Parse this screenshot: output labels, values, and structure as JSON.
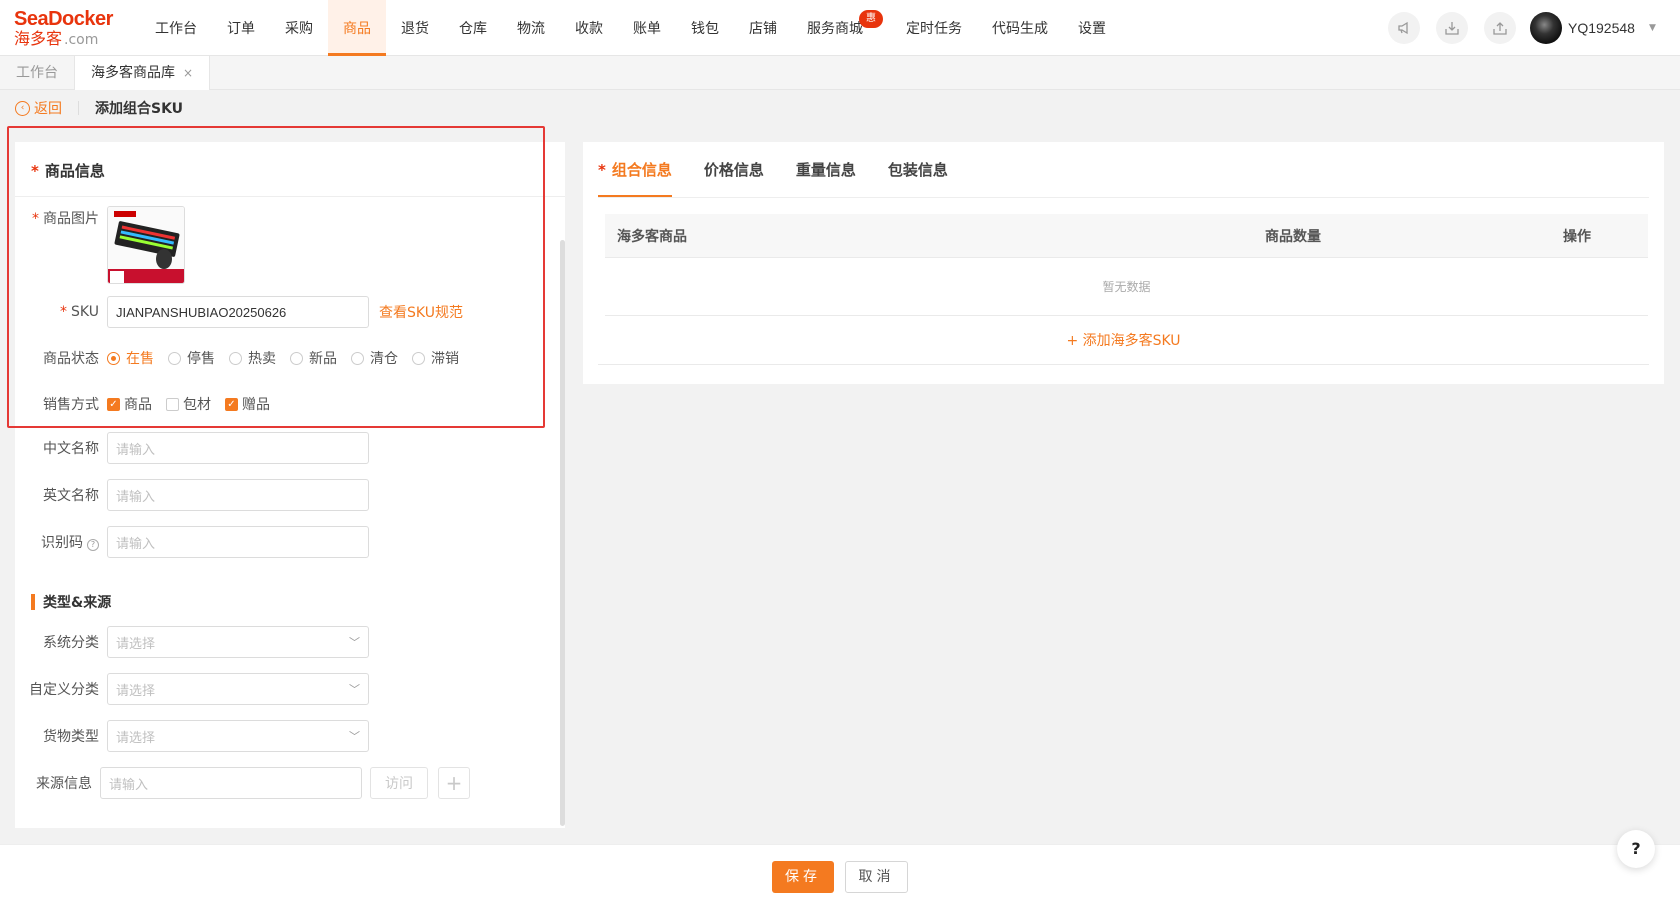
{
  "logo": {
    "brand": "SeaDocker",
    "sub": "海多客",
    "domain": ".com"
  },
  "nav": {
    "items": [
      {
        "label": "工作台"
      },
      {
        "label": "订单"
      },
      {
        "label": "采购"
      },
      {
        "label": "商品"
      },
      {
        "label": "退货"
      },
      {
        "label": "仓库"
      },
      {
        "label": "物流"
      },
      {
        "label": "收款"
      },
      {
        "label": "账单"
      },
      {
        "label": "钱包"
      },
      {
        "label": "店铺"
      },
      {
        "label": "服务商城"
      },
      {
        "label": "定时任务"
      },
      {
        "label": "代码生成"
      },
      {
        "label": "设置"
      }
    ],
    "active_index": 3,
    "badge": "惠",
    "user": "YQ192548"
  },
  "page_tabs": [
    {
      "label": "工作台"
    },
    {
      "label": "海多客商品库",
      "close": "×"
    }
  ],
  "breadcrumb": {
    "back": "返回",
    "title": "添加组合SKU"
  },
  "left": {
    "title": "商品信息",
    "image_label": "商品图片",
    "sku_label": "SKU",
    "sku_value": "JIANPANSHUBIAO20250626",
    "sku_link": "查看SKU规范",
    "status_label": "商品状态",
    "status_options": [
      "在售",
      "停售",
      "热卖",
      "新品",
      "清仓",
      "滞销"
    ],
    "sale_label": "销售方式",
    "sale_options": [
      {
        "label": "商品",
        "checked": true
      },
      {
        "label": "包材",
        "checked": false
      },
      {
        "label": "赠品",
        "checked": true
      }
    ],
    "cn_name_label": "中文名称",
    "en_name_label": "英文名称",
    "code_label": "识别码",
    "input_placeholder": "请输入",
    "section2": "类型&来源",
    "sys_cat_label": "系统分类",
    "custom_cat_label": "自定义分类",
    "goods_type_label": "货物类型",
    "select_placeholder": "请选择",
    "source_label": "来源信息",
    "visit_btn": "访问",
    "plus_btn": "+"
  },
  "right": {
    "tabs": [
      "组合信息",
      "价格信息",
      "重量信息",
      "包装信息"
    ],
    "table_headers": [
      "海多客商品",
      "商品数量",
      "操作"
    ],
    "empty": "暂无数据",
    "add_sku": "+ 添加海多客SKU"
  },
  "footer": {
    "save": "保存",
    "cancel": "取消"
  },
  "help": "?",
  "colors": {
    "accent": "#f47a20",
    "required": "#e8340d",
    "highlight_box": "#e53935"
  }
}
